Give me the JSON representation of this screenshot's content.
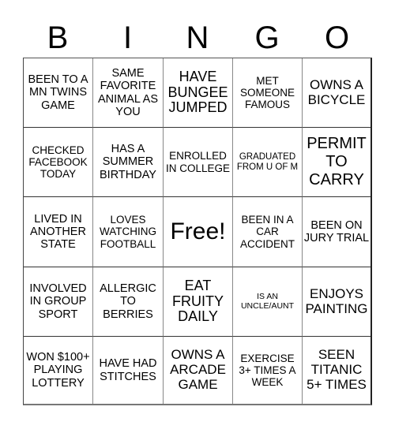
{
  "header": {
    "letters": [
      "B",
      "I",
      "N",
      "G",
      "O"
    ]
  },
  "board": {
    "rows": [
      [
        "BEEN TO A MN TWINS GAME",
        "SAME FAVORITE ANIMAL AS YOU",
        "HAVE BUNGEE JUMPED",
        "MET SOMEONE FAMOUS",
        "OWNS A BICYCLE"
      ],
      [
        "CHECKED FACEBOOK TODAY",
        "HAS A SUMMER BIRTHDAY",
        "ENROLLED IN COLLEGE",
        "GRADUATED FROM U OF M",
        "PERMIT TO CARRY"
      ],
      [
        "LIVED IN ANOTHER STATE",
        "LOVES WATCHING FOOTBALL",
        "Free!",
        "BEEN IN A CAR ACCIDENT",
        "BEEN ON JURY TRIAL"
      ],
      [
        "INVOLVED IN GROUP SPORT",
        "ALLERGIC TO BERRIES",
        "EAT FRUITY DAILY",
        "IS AN UNCLE/AUNT",
        "ENJOYS PAINTING"
      ],
      [
        "WON $100+ PLAYING LOTTERY",
        "HAVE HAD STITCHES",
        "OWNS A ARCADE GAME",
        "EXERCISE 3+ TIMES A WEEK",
        "SEEN TITANIC 5+ TIMES"
      ]
    ]
  }
}
